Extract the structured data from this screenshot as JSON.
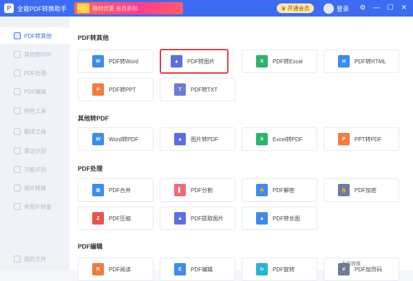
{
  "titlebar": {
    "logo_glyph": "P",
    "app_title": "全能PDF转换助手",
    "promo_text": "限时优惠 会员折扣",
    "open_vip_icon": "crown-icon",
    "open_vip_label": "开通会员",
    "login_label": "登录",
    "controls": [
      "⚙",
      "—",
      "☐",
      "✕"
    ],
    "accent": "#3d6cf2"
  },
  "sidebar": {
    "items": [
      {
        "label": "PDF转其他",
        "active": true
      },
      {
        "label": "其他转PDF"
      },
      {
        "label": "PDF处理"
      },
      {
        "label": "PDF编辑"
      },
      {
        "label": "特色工具"
      },
      {
        "label": "翻译工具"
      },
      {
        "label": "票证识别"
      },
      {
        "label": "万能识别"
      },
      {
        "label": "图片转换"
      },
      {
        "label": "老照片修复"
      }
    ],
    "bottom_item": {
      "label": "我的文件"
    }
  },
  "sections": {
    "pdf_to_other": {
      "title": "PDF转其他",
      "cards": [
        {
          "label": "PDF转Word",
          "icon": "word-icon",
          "color": "#3d8bf2",
          "glyph": "W"
        },
        {
          "label": "PDF转图片",
          "icon": "image-icon",
          "color": "#5b6ee8",
          "glyph": "▲"
        },
        {
          "label": "PDF转Excel",
          "icon": "excel-icon",
          "color": "#2fb36a",
          "glyph": "X"
        },
        {
          "label": "PDF转HTML",
          "icon": "html-icon",
          "color": "#3d8bf2",
          "glyph": "H"
        },
        {
          "label": "PDF转PPT",
          "icon": "ppt-icon",
          "color": "#f27b3d",
          "glyph": "P"
        },
        {
          "label": "PDF转TXT",
          "icon": "txt-icon",
          "color": "#6f7bd8",
          "glyph": "T"
        }
      ]
    },
    "other_to_pdf": {
      "title": "其他转PDF",
      "cards": [
        {
          "label": "Word转PDF",
          "icon": "word-icon",
          "color": "#3d8bf2",
          "glyph": "W"
        },
        {
          "label": "图片转PDF",
          "icon": "image-icon",
          "color": "#5b6ee8",
          "glyph": "▲"
        },
        {
          "label": "Excel转PDF",
          "icon": "excel-icon",
          "color": "#2fb36a",
          "glyph": "X"
        },
        {
          "label": "PPT转PDF",
          "icon": "ppt-icon",
          "color": "#f27b3d",
          "glyph": "P"
        }
      ]
    },
    "pdf_process": {
      "title": "PDF处理",
      "cards": [
        {
          "label": "PDF合并",
          "icon": "merge-icon",
          "color": "#3d8bf2",
          "glyph": "▦"
        },
        {
          "label": "PDF分割",
          "icon": "split-icon",
          "color": "#f06a78",
          "glyph": "▌"
        },
        {
          "label": "PDF解密",
          "icon": "unlock-icon",
          "color": "#3d8bf2",
          "glyph": "🔓"
        },
        {
          "label": "PDF加密",
          "icon": "lock-icon",
          "color": "#6f7b9a",
          "glyph": "🔒"
        },
        {
          "label": "PDF压缩",
          "icon": "compress-icon",
          "color": "#e8554a",
          "glyph": "Z"
        },
        {
          "label": "PDF提取图片",
          "icon": "extract-image-icon",
          "color": "#5b6ee8",
          "glyph": "▲"
        },
        {
          "label": "PDF转长图",
          "icon": "long-image-icon",
          "color": "#3d8bf2",
          "glyph": "▲"
        }
      ]
    },
    "pdf_edit": {
      "title": "PDF编辑",
      "cards": [
        {
          "label": "PDF阅读",
          "icon": "read-icon",
          "color": "#f27b3d",
          "glyph": "R"
        },
        {
          "label": "PDF编辑",
          "icon": "edit-icon",
          "color": "#3d8bf2",
          "glyph": "E"
        },
        {
          "label": "PDF旋转",
          "icon": "rotate-icon",
          "color": "#29b6c9",
          "glyph": "↻"
        },
        {
          "label": "PDF加页码",
          "icon": "page-number-icon",
          "color": "#6f7b9a",
          "glyph": "#"
        }
      ]
    }
  },
  "footer": {
    "phone_transfer": "手机转换"
  }
}
